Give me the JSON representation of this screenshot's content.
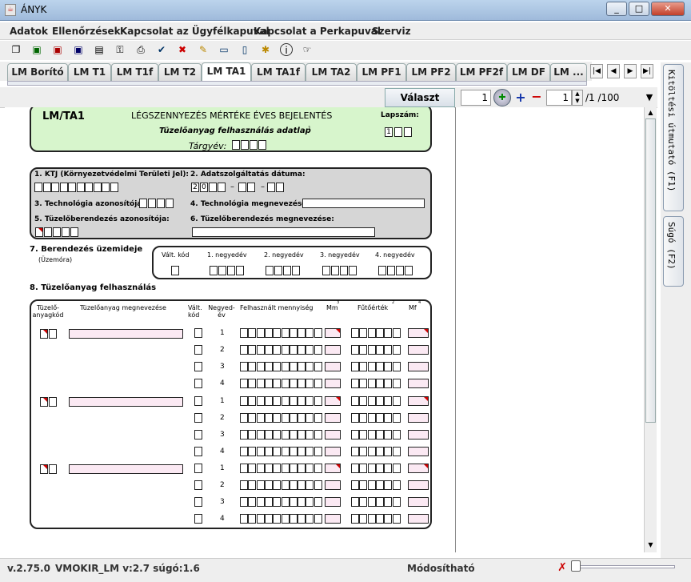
{
  "window": {
    "title": "ÁNYK",
    "min": "_",
    "max": "□",
    "close": "✕"
  },
  "menu": [
    "Adatok",
    "Ellenőrzések",
    "Kapcsolat az Ügyfélkapuval",
    "Kapcsolat a Perkapuval",
    "Szerviz"
  ],
  "tabs": [
    "LM Borító",
    "LM T1",
    "LM T1f",
    "LM T2",
    "LM TA1",
    "LM TA1f",
    "LM TA2",
    "LM PF1",
    "LM PF2",
    "LM PF2f",
    "LM DF",
    "LM ..."
  ],
  "active_tab": "LM TA1",
  "pagebar": {
    "select_label": "Választ",
    "page_value": "1",
    "sheet_value": "1",
    "sheet_total": "/1 /100"
  },
  "side": {
    "guide": "Kitöltési útmutató (F1)",
    "help": "Súgó (F2)"
  },
  "form": {
    "code": "LM/TA1",
    "title": "LÉGSZENNYEZÉS MÉRTÉKE ÉVES BEJELENTÉS",
    "sub": "Tüzelőanyag felhasználás adatlap",
    "sub_sup": "1",
    "year_label": "Tárgyév:",
    "lapszam": "Lapszám:",
    "lapszam_value": "1",
    "f1": "1. KTJ (Környezetvédelmi Területi Jel):",
    "f2": "2. Adatszolgáltatás dátuma:",
    "date_prefix": [
      "2",
      "0"
    ],
    "dash": "–",
    "f3": "3. Technológia azonosítója:",
    "f4": "4. Technológia megnevezése:",
    "f5": "5. Tüzelőberendezés azonosítója:",
    "f6": "6. Tüzelőberendezés megnevezése:",
    "s7": "7. Berendezés üzemideje",
    "s7_unit": "(Üzemóra)",
    "s7_cols": [
      "Vált. kód",
      "1. negyedév",
      "2. negyedév",
      "3. negyedév",
      "4. negyedév"
    ],
    "s8": "8. Tüzelőanyag felhasználás",
    "s8_cols": {
      "kod": "Tüzelő-anyagkód",
      "nev": "Tüzelőanyag megnevezése",
      "valt": "Vált. kód",
      "negyed": "Negyed-év",
      "menny": "Felhasznált mennyiség",
      "mm": "Mm",
      "mm_sup": "3",
      "fut": "Fűtőérték",
      "fut_sup": "2",
      "mf": "Mf",
      "mf_sup": "4"
    },
    "quarters": [
      "1",
      "2",
      "3",
      "4"
    ]
  },
  "status": {
    "version": "v.2.75.0",
    "template": "VMOKIR_LM v:2.7 súgó:1.6",
    "mode": "Módosítható"
  }
}
